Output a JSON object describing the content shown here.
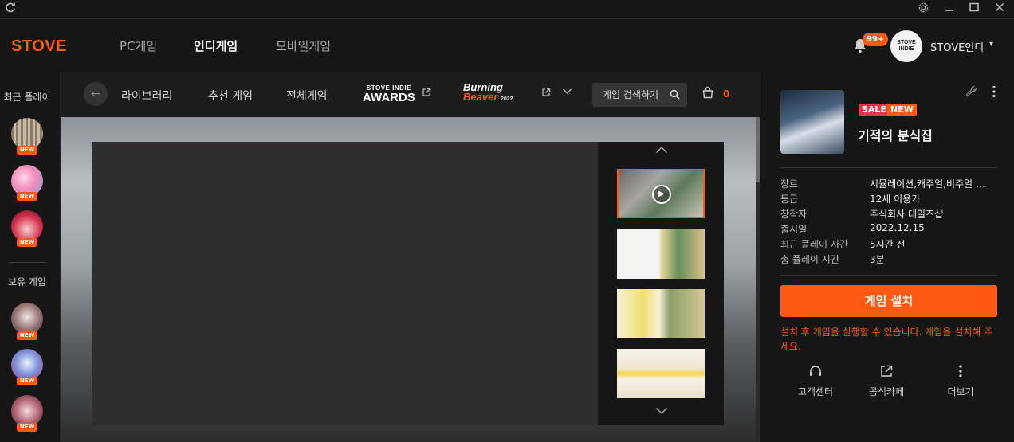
{
  "window": {
    "refresh_icon": "refresh-icon",
    "controls": [
      "gear-icon",
      "minimize-icon",
      "maximize-icon",
      "close-icon"
    ]
  },
  "topnav": {
    "logo": "STOVE",
    "items": [
      "PC게임",
      "인디게임",
      "모바일게임"
    ],
    "active": "인디게임",
    "notification_count": "99+",
    "avatar_text": "STOVE INDIE",
    "user_name": "STOVE인디"
  },
  "leftrail": {
    "recent_label": "최근 플레이",
    "owned_label": "보유 게임",
    "new_badge": "NEW"
  },
  "subnav": {
    "items": [
      "라이브러리",
      "추천 게임",
      "전체게임"
    ],
    "awards_top": "STOVE INDIE",
    "awards_bottom": "AWARDS",
    "burning_1": "Burning",
    "burning_2": "Beaver",
    "burning_year": "2022",
    "search_label": "게임 검색하기",
    "cart_count": "0"
  },
  "game": {
    "tag_sale": "SALE",
    "tag_new": "NEW",
    "title": "기적의 분식집",
    "info": [
      {
        "key": "장르",
        "value": "시뮬레이션,캐주얼,비주얼 …"
      },
      {
        "key": "등급",
        "value": "12세 이용가"
      },
      {
        "key": "창작자",
        "value": "주식회사 테일즈샵"
      },
      {
        "key": "출시일",
        "value": "2022.12.15"
      },
      {
        "key": "최근 플레이 시간",
        "value": "5시간 전"
      },
      {
        "key": "총 플레이 시간",
        "value": "3분"
      }
    ],
    "install_label": "게임 설치",
    "install_note": "설치 후 게임을 실행할 수 있습니다. 게임을 설치해 주세요.",
    "footer": [
      {
        "label": "고객센터",
        "icon": "headset-icon"
      },
      {
        "label": "공식카페",
        "icon": "external-link-icon"
      },
      {
        "label": "더보기",
        "icon": "more-vertical-icon"
      }
    ]
  },
  "colors": {
    "accent": "#ff5a14",
    "sale": "#e6344a",
    "background": "#161616"
  }
}
